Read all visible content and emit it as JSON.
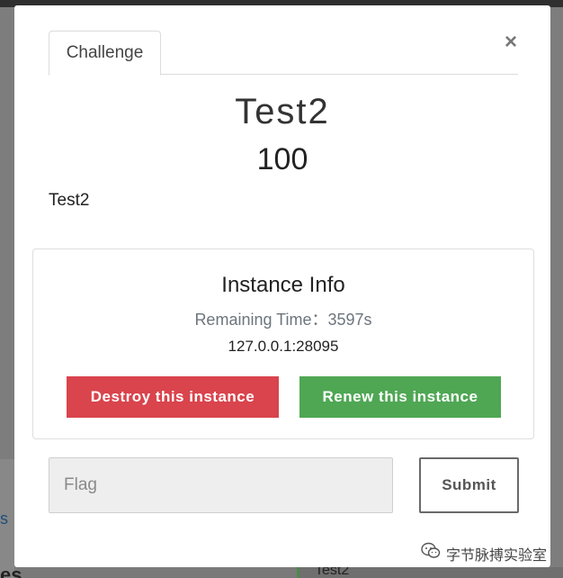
{
  "modal": {
    "tab_label": "Challenge",
    "close_glyph": "×",
    "challenge_name": "Test2",
    "points": "100",
    "description": "Test2"
  },
  "instance": {
    "title": "Instance Info",
    "remaining_time": "Remaining Time：3597s",
    "address": "127.0.0.1:28095",
    "destroy_label": "Destroy this instance",
    "renew_label": "Renew this instance",
    "destroy_color": "#d9444d",
    "renew_color": "#4fa754"
  },
  "flag_form": {
    "placeholder": "Flag",
    "value": "",
    "submit_label": "Submit"
  },
  "background": {
    "fragment_1": "s",
    "fragment_2": "es",
    "fragment_3": "Test2"
  },
  "watermark": {
    "text": "字节脉搏实验室",
    "icon": "wechat-icon"
  }
}
